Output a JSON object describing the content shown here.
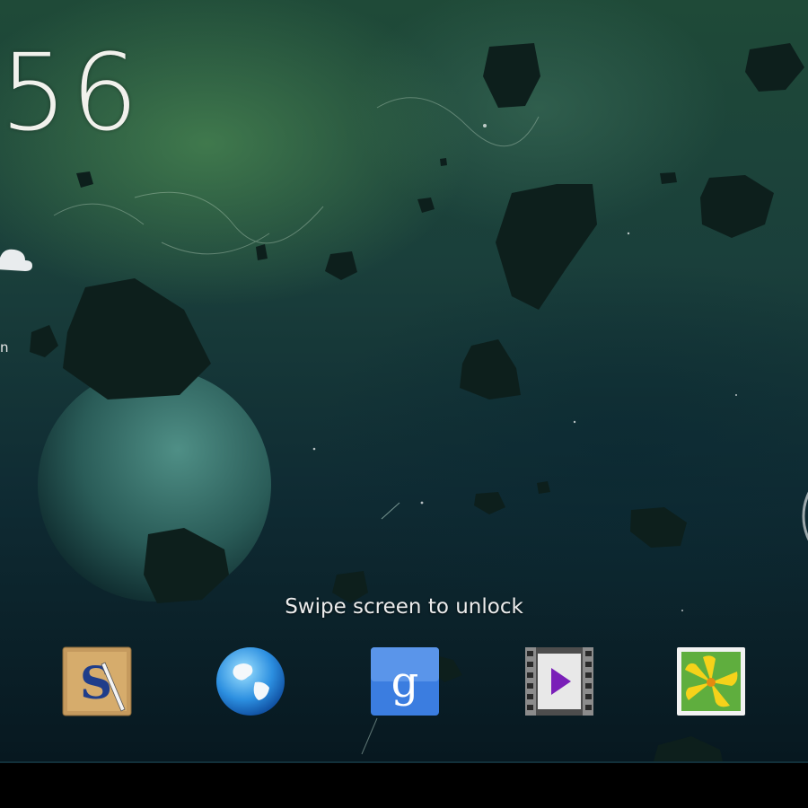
{
  "lockscreen": {
    "clock_partial": "56",
    "weather_partial": "n",
    "unlock_hint": "Swipe screen to unlock"
  },
  "dock": {
    "apps": [
      {
        "name": "Sketch S app",
        "icon": "sketch-s-icon"
      },
      {
        "name": "Browser",
        "icon": "globe-icon"
      },
      {
        "name": "Google Search",
        "icon": "google-g-icon"
      },
      {
        "name": "Video Player",
        "icon": "video-play-icon"
      },
      {
        "name": "Gallery",
        "icon": "flower-gallery-icon"
      }
    ]
  },
  "colors": {
    "clock_text": "#f1f1ec",
    "google_blue": "#3b7de0",
    "video_play": "#7a1fb8",
    "gallery_yellow": "#f5d21a"
  }
}
